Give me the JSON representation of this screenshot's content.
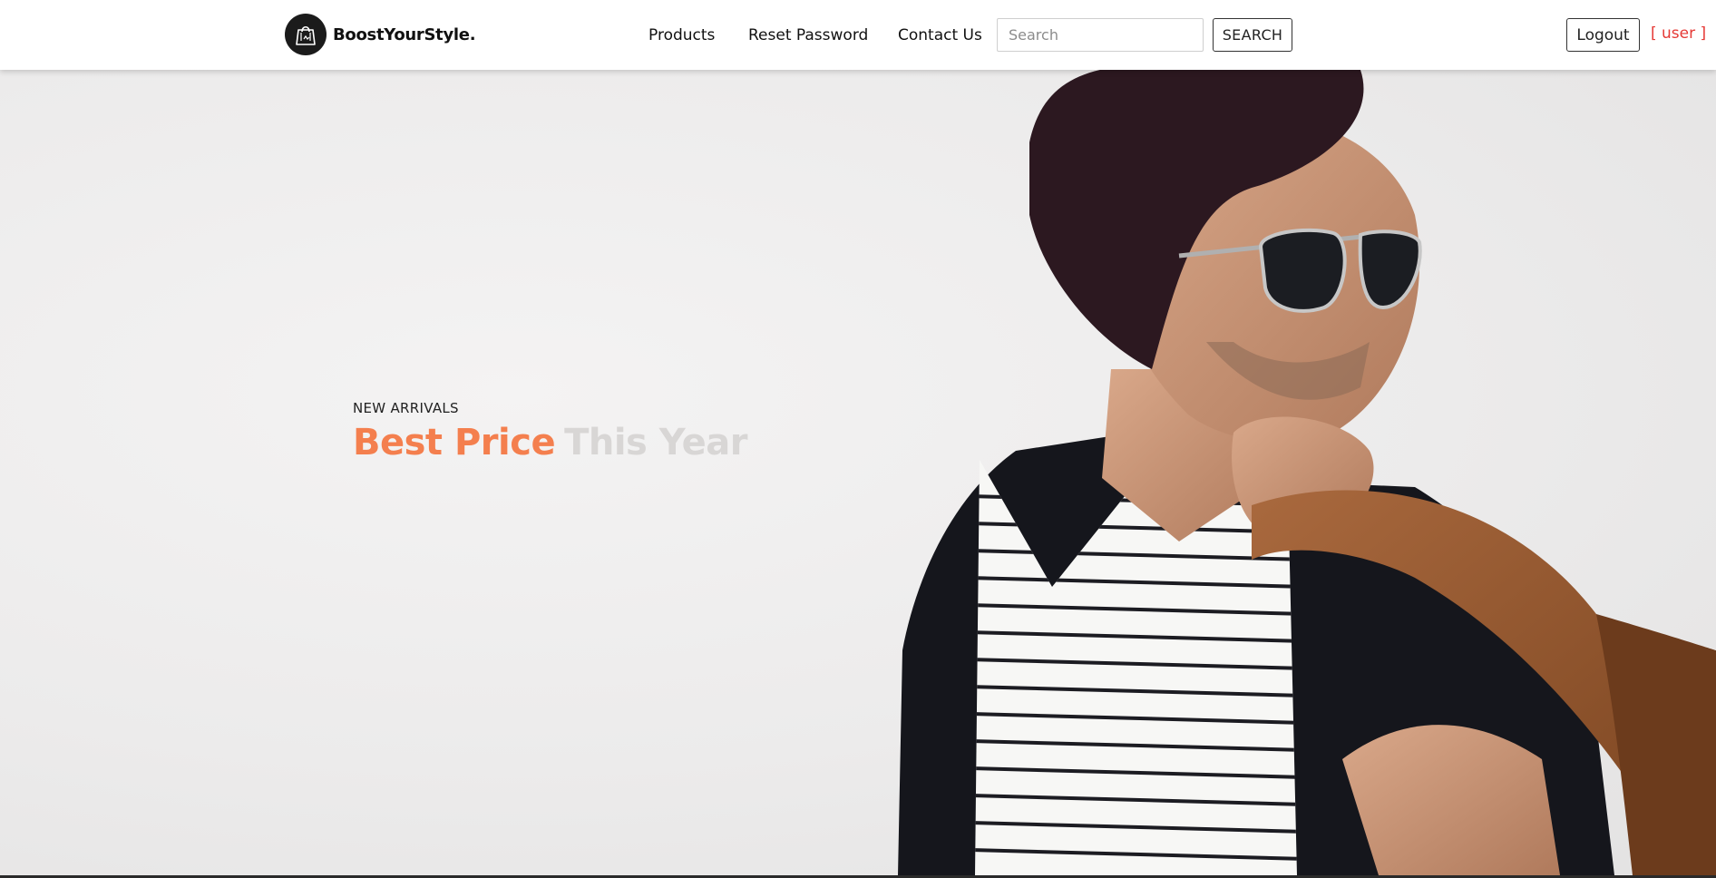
{
  "header": {
    "brand": "BoostYourStyle.",
    "logo_icon": "shopping-bag-icon",
    "nav": {
      "products": "Products",
      "reset_password": "Reset Password",
      "contact_us": "Contact Us"
    },
    "search": {
      "placeholder": "Search",
      "value": "",
      "button_label": "SEARCH"
    },
    "logout_label": "Logout",
    "user_label": "[ user ]",
    "colors": {
      "user_label": "#e53935"
    }
  },
  "hero": {
    "eyebrow": "NEW ARRIVALS",
    "title_accent": "Best Price",
    "title_faded": "This Year",
    "image": "man-in-beanie-sunglasses-with-leather-bag",
    "colors": {
      "accent": "#f47f4e",
      "faded": "#d8d6d5"
    }
  }
}
